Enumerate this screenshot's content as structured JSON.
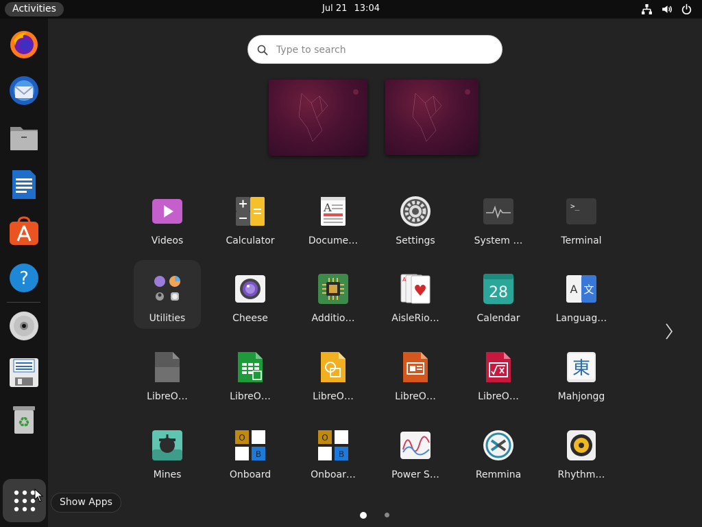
{
  "topbar": {
    "activities_label": "Activities",
    "date": "Jul 21",
    "time": "13:04",
    "tray_icons": [
      "network-icon",
      "volume-icon",
      "power-icon"
    ]
  },
  "dock": {
    "items": [
      {
        "name": "firefox-icon",
        "app": "Firefox"
      },
      {
        "name": "thunderbird-icon",
        "app": "Thunderbird"
      },
      {
        "name": "files-icon",
        "app": "Files"
      },
      {
        "name": "writer-icon",
        "app": "LibreOffice Writer"
      },
      {
        "name": "app-center-icon",
        "app": "Ubuntu Software"
      },
      {
        "name": "help-icon",
        "app": "Help"
      },
      {
        "name": "disc-icon",
        "app": "Disc"
      },
      {
        "name": "save-icon",
        "app": "Save"
      },
      {
        "name": "trash-icon",
        "app": "Trash"
      }
    ],
    "show_apps_tooltip": "Show Apps"
  },
  "search": {
    "placeholder": "Type to search",
    "value": ""
  },
  "workspaces": {
    "count": 2
  },
  "app_grid": {
    "rows": [
      [
        {
          "label": "Videos",
          "icon": "videos-icon"
        },
        {
          "label": "Calculator",
          "icon": "calculator-icon"
        },
        {
          "label": "Docume…",
          "icon": "document-viewer-icon"
        },
        {
          "label": "Settings",
          "icon": "settings-gear-icon"
        },
        {
          "label": "System …",
          "icon": "system-monitor-icon"
        },
        {
          "label": "Terminal",
          "icon": "terminal-icon"
        }
      ],
      [
        {
          "label": "Utilities",
          "icon": "utilities-folder-icon"
        },
        {
          "label": "Cheese",
          "icon": "cheese-camera-icon"
        },
        {
          "label": "Additio…",
          "icon": "additional-drivers-chip-icon"
        },
        {
          "label": "AisleRio…",
          "icon": "aisleriot-cards-icon"
        },
        {
          "label": "Calendar",
          "icon": "calendar-icon"
        },
        {
          "label": "Languag…",
          "icon": "language-icon"
        }
      ],
      [
        {
          "label": "LibreO…",
          "icon": "libreoffice-icon"
        },
        {
          "label": "LibreO…",
          "icon": "libreoffice-calc-icon"
        },
        {
          "label": "LibreO…",
          "icon": "libreoffice-draw-icon"
        },
        {
          "label": "LibreO…",
          "icon": "libreoffice-impress-icon"
        },
        {
          "label": "LibreO…",
          "icon": "libreoffice-math-icon"
        },
        {
          "label": "Mahjongg",
          "icon": "mahjongg-icon"
        }
      ],
      [
        {
          "label": "Mines",
          "icon": "mines-icon"
        },
        {
          "label": "Onboard",
          "icon": "onboard-keyboard-icon"
        },
        {
          "label": "Onboar…",
          "icon": "onboard-settings-icon"
        },
        {
          "label": "Power S…",
          "icon": "power-statistics-icon"
        },
        {
          "label": "Remmina",
          "icon": "remmina-icon"
        },
        {
          "label": "Rhythm…",
          "icon": "rhythmbox-icon"
        }
      ]
    ],
    "selected": "Utilities",
    "calendar_day": "28",
    "mahjongg_glyph": "東",
    "terminal_prompt": ">_",
    "language_glyphs": [
      "A",
      "文"
    ],
    "onboard_letters": [
      "O",
      "B"
    ]
  },
  "pagination": {
    "pages": 2,
    "current": 1
  }
}
